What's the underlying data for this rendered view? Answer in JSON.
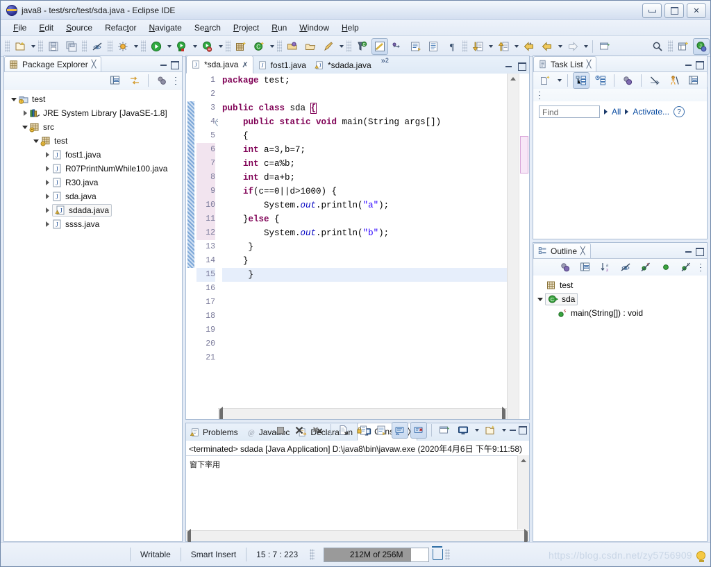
{
  "window": {
    "title": "java8 - test/src/test/sda.java - Eclipse IDE",
    "app_icon": "eclipse-icon",
    "minimize": "minimize",
    "maximize": "maximize",
    "close": "close"
  },
  "menubar": [
    {
      "label": "File",
      "accel": "F"
    },
    {
      "label": "Edit",
      "accel": "E"
    },
    {
      "label": "Source",
      "accel": "S"
    },
    {
      "label": "Refactor",
      "accel": "t"
    },
    {
      "label": "Navigate",
      "accel": "N"
    },
    {
      "label": "Search",
      "accel": "a"
    },
    {
      "label": "Project",
      "accel": "P"
    },
    {
      "label": "Run",
      "accel": "R"
    },
    {
      "label": "Window",
      "accel": "W"
    },
    {
      "label": "Help",
      "accel": "H"
    }
  ],
  "toolbar": {
    "items": [
      {
        "name": "new-wizard-icon",
        "dropdown": true
      },
      {
        "name": "save-icon",
        "dropdown": false
      },
      {
        "name": "save-all-icon",
        "dropdown": false
      },
      {
        "name": "toggle-mark-occurrences-icon",
        "dropdown": false
      },
      {
        "name": "debug-icon",
        "dropdown": true
      },
      {
        "name": "run-icon",
        "dropdown": true
      },
      {
        "name": "run-last-tool-icon",
        "dropdown": true
      },
      {
        "name": "coverage-icon",
        "dropdown": true
      },
      {
        "name": "new-java-package-icon",
        "dropdown": false
      },
      {
        "name": "new-java-class-icon",
        "dropdown": true
      },
      {
        "name": "open-type-icon",
        "dropdown": false
      },
      {
        "name": "open-task-icon",
        "dropdown": false
      },
      {
        "name": "external-tools-icon",
        "dropdown": true
      },
      {
        "name": "skip-all-breakpoints-icon",
        "dropdown": false
      },
      {
        "name": "toggle-block-selection-icon",
        "dropdown": false
      },
      {
        "name": "toggle-word-wrap-icon",
        "dropdown": false
      },
      {
        "name": "show-whitespace-icon",
        "dropdown": false
      },
      {
        "name": "next-annotation-icon",
        "dropdown": true
      },
      {
        "name": "previous-annotation-icon",
        "dropdown": true
      },
      {
        "name": "last-edit-location-icon",
        "dropdown": false
      },
      {
        "name": "back-icon",
        "dropdown": true
      },
      {
        "name": "forward-icon",
        "dropdown": true
      },
      {
        "name": "new-window-icon",
        "dropdown": false
      },
      {
        "name": "search-icon",
        "dropdown": false
      },
      {
        "name": "open-perspective-icon",
        "dropdown": false
      },
      {
        "name": "java-perspective-icon",
        "dropdown": false
      }
    ]
  },
  "package_explorer": {
    "title": "Package Explorer",
    "close_glyph": "╳",
    "toolbar": [
      {
        "name": "collapse-all-icon"
      },
      {
        "name": "link-with-editor-icon"
      },
      {
        "name": "view-menu-filter-icon"
      },
      {
        "name": "view-menu-icon"
      }
    ],
    "tree": [
      {
        "label": "test",
        "icon": "java-project-icon",
        "indent": 0,
        "twisty": "open",
        "selected": false,
        "warning": true
      },
      {
        "label": "JRE System Library",
        "suffix": "[JavaSE-1.8]",
        "icon": "library-icon",
        "indent": 1,
        "twisty": "closed",
        "selected": false
      },
      {
        "label": "src",
        "icon": "source-folder-icon",
        "indent": 1,
        "twisty": "open",
        "selected": false
      },
      {
        "label": "test",
        "icon": "package-icon",
        "indent": 2,
        "twisty": "open",
        "selected": false,
        "warning": true
      },
      {
        "label": "fost1.java",
        "icon": "java-file-icon",
        "indent": 3,
        "twisty": "closed",
        "selected": false
      },
      {
        "label": "R07PrintNumWhile100.java",
        "icon": "java-file-icon",
        "indent": 3,
        "twisty": "closed",
        "selected": false
      },
      {
        "label": "R30.java",
        "icon": "java-file-icon",
        "indent": 3,
        "twisty": "closed",
        "selected": false
      },
      {
        "label": "sda.java",
        "icon": "java-file-icon",
        "indent": 3,
        "twisty": "closed",
        "selected": false
      },
      {
        "label": "sdada.java",
        "icon": "java-file-warning-icon",
        "indent": 3,
        "twisty": "closed",
        "selected": true
      },
      {
        "label": "ssss.java",
        "icon": "java-file-icon",
        "indent": 3,
        "twisty": "closed",
        "selected": false
      }
    ]
  },
  "editor": {
    "tabs": [
      {
        "label": "*sda.java",
        "icon": "java-file-icon",
        "active": true,
        "closable": true
      },
      {
        "label": "fost1.java",
        "icon": "java-file-icon",
        "active": false,
        "closable": false
      },
      {
        "label": "*sdada.java",
        "icon": "java-file-warning-icon",
        "active": false,
        "closable": false
      }
    ],
    "overflow_chevron": "»",
    "overflow_count": "2",
    "lines": [
      {
        "n": "1",
        "tokens": [
          {
            "t": "package ",
            "c": "kw"
          },
          {
            "t": "test;",
            "c": "plain"
          }
        ]
      },
      {
        "n": "2",
        "tokens": []
      },
      {
        "n": "3",
        "tokens": [
          {
            "t": "public class ",
            "c": "kw"
          },
          {
            "t": "sda ",
            "c": "plain"
          },
          {
            "t": "{",
            "c": "brk"
          }
        ]
      },
      {
        "n": "4",
        "fold": true,
        "tokens": [
          {
            "t": "    ",
            "c": "plain"
          },
          {
            "t": "public static void ",
            "c": "kw"
          },
          {
            "t": "main(String args[])",
            "c": "plain"
          }
        ]
      },
      {
        "n": "5",
        "tokens": [
          {
            "t": "    {",
            "c": "plain"
          }
        ]
      },
      {
        "n": "6",
        "hl": true,
        "tokens": [
          {
            "t": "    ",
            "c": "plain"
          },
          {
            "t": "int ",
            "c": "kw"
          },
          {
            "t": "a=3,b=7;",
            "c": "plain"
          }
        ]
      },
      {
        "n": "7",
        "hl": true,
        "tokens": [
          {
            "t": "    ",
            "c": "plain"
          },
          {
            "t": "int ",
            "c": "kw"
          },
          {
            "t": "c=a%b;",
            "c": "plain"
          }
        ]
      },
      {
        "n": "8",
        "hl": true,
        "tokens": [
          {
            "t": "    ",
            "c": "plain"
          },
          {
            "t": "int ",
            "c": "kw"
          },
          {
            "t": "d=a+b;",
            "c": "plain"
          }
        ]
      },
      {
        "n": "9",
        "hl": true,
        "tokens": [
          {
            "t": "    ",
            "c": "plain"
          },
          {
            "t": "if",
            "c": "kw"
          },
          {
            "t": "(c==0||d>1000) {",
            "c": "plain"
          }
        ]
      },
      {
        "n": "10",
        "hl": true,
        "tokens": [
          {
            "t": "        System.",
            "c": "plain"
          },
          {
            "t": "out",
            "c": "fld"
          },
          {
            "t": ".println(",
            "c": "plain"
          },
          {
            "t": "\"a\"",
            "c": "str"
          },
          {
            "t": ");",
            "c": "plain"
          }
        ]
      },
      {
        "n": "11",
        "hl": true,
        "tokens": [
          {
            "t": "    }",
            "c": "plain"
          },
          {
            "t": "else",
            "c": "kw"
          },
          {
            "t": " {",
            "c": "plain"
          }
        ]
      },
      {
        "n": "12",
        "hl": true,
        "tokens": [
          {
            "t": "        System.",
            "c": "plain"
          },
          {
            "t": "out",
            "c": "fld"
          },
          {
            "t": ".println(",
            "c": "plain"
          },
          {
            "t": "\"b\"",
            "c": "str"
          },
          {
            "t": ");",
            "c": "plain"
          }
        ]
      },
      {
        "n": "13",
        "tokens": [
          {
            "t": "     }",
            "c": "plain"
          }
        ]
      },
      {
        "n": "14",
        "tokens": [
          {
            "t": "    }",
            "c": "plain"
          }
        ]
      },
      {
        "n": "15",
        "cur": true,
        "tokens": [
          {
            "t": "     }",
            "c": "plain"
          }
        ]
      },
      {
        "n": "16",
        "tokens": []
      },
      {
        "n": "17",
        "tokens": []
      },
      {
        "n": "18",
        "tokens": []
      },
      {
        "n": "19",
        "tokens": []
      },
      {
        "n": "20",
        "tokens": []
      },
      {
        "n": "21",
        "tokens": []
      }
    ]
  },
  "task_list": {
    "title": "Task List",
    "close_glyph": "╳",
    "toolbar": [
      {
        "name": "new-task-icon"
      },
      {
        "name": "categorized-presentation-icon"
      },
      {
        "name": "scheduled-presentation-icon"
      },
      {
        "name": "focus-on-workweek-icon"
      },
      {
        "name": "synchronize-changed-icon"
      },
      {
        "name": "show-task-hierarchy-icon"
      },
      {
        "name": "collapse-all-icon"
      },
      {
        "name": "restore-tasks-icon"
      },
      {
        "name": "view-menu-icon"
      }
    ],
    "find_placeholder": "Find",
    "filter_all": "All",
    "filter_activate": "Activate...",
    "help_glyph": "?"
  },
  "outline": {
    "title": "Outline",
    "close_glyph": "╳",
    "toolbar": [
      {
        "name": "focus-on-active-task-icon"
      },
      {
        "name": "collapse-all-icon"
      },
      {
        "name": "sort-icon"
      },
      {
        "name": "hide-fields-icon"
      },
      {
        "name": "hide-static-members-icon"
      },
      {
        "name": "hide-non-public-icon"
      },
      {
        "name": "hide-local-types-icon"
      },
      {
        "name": "view-menu-icon"
      }
    ],
    "tree": [
      {
        "label": "test",
        "icon": "package-icon",
        "indent": 0,
        "twisty": "none",
        "selected": false
      },
      {
        "label": "sda",
        "icon": "class-icon",
        "indent": 0,
        "twisty": "open",
        "selected": true
      },
      {
        "label": "main(String[]) : void",
        "icon": "public-method-icon",
        "badge": "S",
        "indent": 1,
        "twisty": "none",
        "selected": false
      }
    ]
  },
  "console": {
    "tabs": [
      {
        "label": "Problems",
        "icon": "problems-icon",
        "active": false
      },
      {
        "label": "Javadoc",
        "icon": "javadoc-icon",
        "active": false
      },
      {
        "label": "Declaration",
        "icon": "declaration-icon",
        "active": false
      },
      {
        "label": "Console",
        "icon": "console-icon",
        "active": true,
        "closable": true
      }
    ],
    "close_glyph": "╳",
    "toolbar": [
      {
        "name": "terminate-icon"
      },
      {
        "name": "remove-launch-icon"
      },
      {
        "name": "remove-all-terminated-icon"
      },
      {
        "name": "clear-console-icon"
      },
      {
        "name": "scroll-lock-icon"
      },
      {
        "name": "word-wrap-icon"
      },
      {
        "name": "show-console-on-output-icon",
        "pressed": true
      },
      {
        "name": "show-console-on-error-icon",
        "pressed": true
      },
      {
        "name": "pin-console-icon"
      },
      {
        "name": "display-selected-console-icon",
        "dropdown": true
      },
      {
        "name": "open-console-icon",
        "dropdown": true
      },
      {
        "name": "minimize-icon"
      },
      {
        "name": "maximize-icon"
      }
    ],
    "terminated_line": "<terminated> sdada [Java Application] D:\\java8\\bin\\javaw.exe (2020年4月6日 下午9:11:58)",
    "output": "窗下率用"
  },
  "statusbar": {
    "writable": "Writable",
    "insert_mode": "Smart Insert",
    "position": "15 : 7 : 223",
    "memory": "212M of 256M",
    "memory_percent": 83,
    "trash_icon": "trash-icon",
    "watermark": "https://blog.csdn.net/zy5756909",
    "tip_icon": "lightbulb-icon"
  },
  "colors": {
    "keyword": "#7f0055",
    "string": "#2a00ff",
    "field": "#0000c0",
    "link": "#0c4da2",
    "selection": "#e6eefb",
    "highlight": "#f2e4ef",
    "chrome": "#e3ebf6"
  }
}
